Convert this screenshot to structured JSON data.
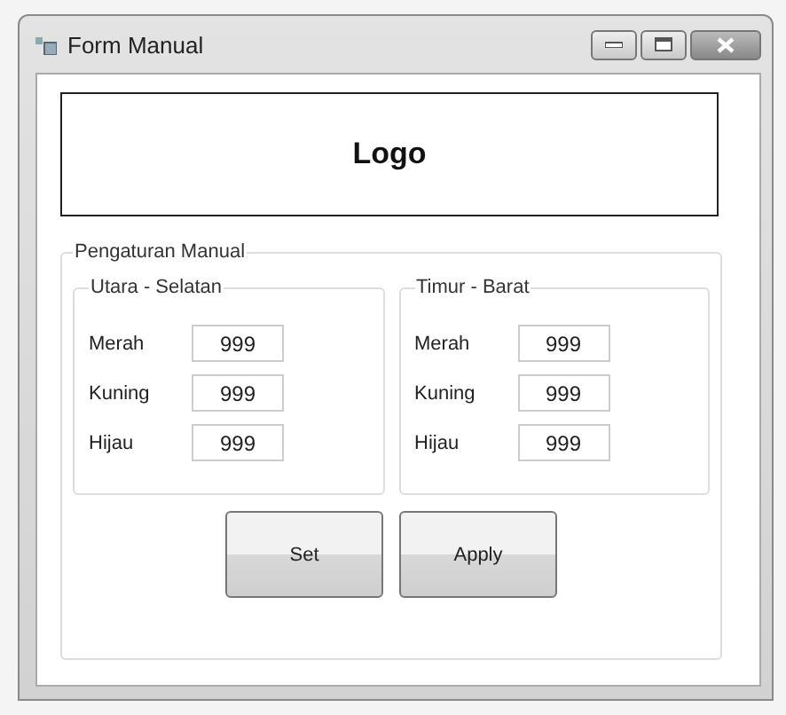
{
  "window": {
    "title": "Form Manual"
  },
  "logo": {
    "text": "Logo"
  },
  "settings": {
    "title": "Pengaturan Manual",
    "groups": [
      {
        "title": "Utara - Selatan",
        "fields": [
          {
            "label": "Merah",
            "value": "999"
          },
          {
            "label": "Kuning",
            "value": "999"
          },
          {
            "label": "Hijau",
            "value": "999"
          }
        ]
      },
      {
        "title": "Timur - Barat",
        "fields": [
          {
            "label": "Merah",
            "value": "999"
          },
          {
            "label": "Kuning",
            "value": "999"
          },
          {
            "label": "Hijau",
            "value": "999"
          }
        ]
      }
    ],
    "buttons": [
      "Set",
      "Apply"
    ]
  }
}
